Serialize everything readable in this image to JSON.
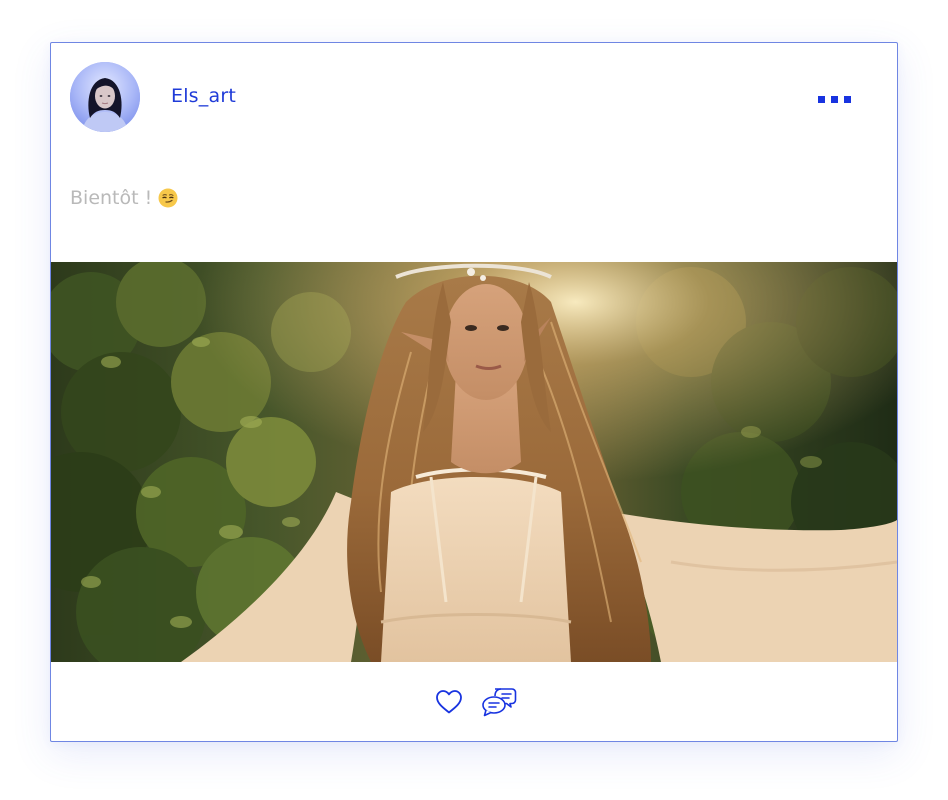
{
  "post": {
    "author": {
      "username": "Els_art",
      "avatar_icon": "profile-photo"
    },
    "menu_icon": "more-dots-icon",
    "caption": {
      "text": "Bientôt !",
      "emoji": "smirking-face"
    },
    "image": {
      "subject": "woman-in-elf-costume-in-forest"
    },
    "actions": [
      {
        "name": "like",
        "icon": "heart-icon"
      },
      {
        "name": "comment",
        "icon": "chat-bubbles-icon"
      }
    ]
  },
  "colors": {
    "accent": "#1f3bd8",
    "border": "#6f86e3",
    "caption_text": "#b9b9b9",
    "icon_blue": "#1833e0"
  }
}
